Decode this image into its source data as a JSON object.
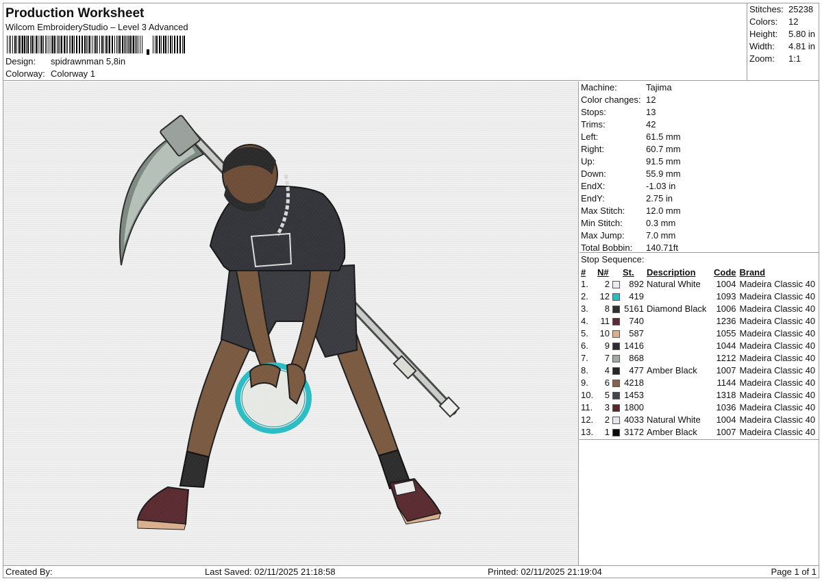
{
  "header": {
    "title": "Production Worksheet",
    "subtitle": "Wilcom EmbroideryStudio – Level 3 Advanced",
    "design_label": "Design:",
    "design_value": "spidrawnman 5,8in",
    "colorway_label": "Colorway:",
    "colorway_value": "Colorway 1"
  },
  "stats": [
    {
      "label": "Stitches:",
      "value": "25238"
    },
    {
      "label": "Colors:",
      "value": "12"
    },
    {
      "label": "Height:",
      "value": "5.80 in"
    },
    {
      "label": "Width:",
      "value": "4.81 in"
    },
    {
      "label": "Zoom:",
      "value": "1:1"
    }
  ],
  "machine": [
    {
      "label": "Machine:",
      "value": "Tajima"
    },
    {
      "label": "Color changes:",
      "value": "12"
    },
    {
      "label": "Stops:",
      "value": "13"
    },
    {
      "label": "Trims:",
      "value": "42"
    },
    {
      "label": "Left:",
      "value": "61.5 mm"
    },
    {
      "label": "Right:",
      "value": "60.7 mm"
    },
    {
      "label": "Up:",
      "value": "91.5 mm"
    },
    {
      "label": "Down:",
      "value": "55.9 mm"
    },
    {
      "label": "EndX:",
      "value": "-1.03 in"
    },
    {
      "label": "EndY:",
      "value": "2.75 in"
    },
    {
      "label": "Max Stitch:",
      "value": "12.0 mm"
    },
    {
      "label": "Min Stitch:",
      "value": "0.3 mm"
    },
    {
      "label": "Max Jump:",
      "value": "7.0 mm"
    },
    {
      "label": "Total Bobbin:",
      "value": "140.71ft"
    }
  ],
  "stop_sequence": {
    "heading": "Stop Sequence:",
    "columns": {
      "idx": "#",
      "n": "N#",
      "st": "St.",
      "desc": "Description",
      "code": "Code",
      "brand": "Brand"
    },
    "rows": [
      {
        "idx": "1.",
        "n": "2",
        "color": "#ececf0",
        "st": "892",
        "desc": "Natural White",
        "code": "1004",
        "brand": "Madeira Classic 40"
      },
      {
        "idx": "2.",
        "n": "12",
        "color": "#2bbcc4",
        "st": "419",
        "desc": "",
        "code": "1093",
        "brand": "Madeira Classic 40"
      },
      {
        "idx": "3.",
        "n": "8",
        "color": "#2f3033",
        "st": "5161",
        "desc": "Diamond Black",
        "code": "1006",
        "brand": "Madeira Classic 40"
      },
      {
        "idx": "4.",
        "n": "11",
        "color": "#5b2b36",
        "st": "740",
        "desc": "",
        "code": "1236",
        "brand": "Madeira Classic 40"
      },
      {
        "idx": "5.",
        "n": "10",
        "color": "#d9b08f",
        "st": "587",
        "desc": "",
        "code": "1055",
        "brand": "Madeira Classic 40"
      },
      {
        "idx": "6.",
        "n": "9",
        "color": "#2a2d35",
        "st": "1416",
        "desc": "",
        "code": "1044",
        "brand": "Madeira Classic 40"
      },
      {
        "idx": "7.",
        "n": "7",
        "color": "#a3aaa6",
        "st": "868",
        "desc": "",
        "code": "1212",
        "brand": "Madeira Classic 40"
      },
      {
        "idx": "8.",
        "n": "4",
        "color": "#262626",
        "st": "477",
        "desc": "Amber Black",
        "code": "1007",
        "brand": "Madeira Classic 40"
      },
      {
        "idx": "9.",
        "n": "6",
        "color": "#8a6346",
        "st": "4218",
        "desc": "",
        "code": "1144",
        "brand": "Madeira Classic 40"
      },
      {
        "idx": "10.",
        "n": "5",
        "color": "#47434c",
        "st": "1453",
        "desc": "",
        "code": "1318",
        "brand": "Madeira Classic 40"
      },
      {
        "idx": "11.",
        "n": "3",
        "color": "#5a2628",
        "st": "1800",
        "desc": "",
        "code": "1036",
        "brand": "Madeira Classic 40"
      },
      {
        "idx": "12.",
        "n": "2",
        "color": "#e6e6ee",
        "st": "4033",
        "desc": "Natural White",
        "code": "1004",
        "brand": "Madeira Classic 40"
      },
      {
        "idx": "13.",
        "n": "1",
        "color": "#0c0c0c",
        "st": "3172",
        "desc": "Amber Black",
        "code": "1007",
        "brand": "Madeira Classic 40"
      }
    ]
  },
  "footer": {
    "created_by": "Created By:",
    "last_saved": "Last Saved: 02/11/2025 21:18:58",
    "printed": "Printed: 02/11/2025 21:19:04",
    "page": "Page 1 of 1"
  }
}
